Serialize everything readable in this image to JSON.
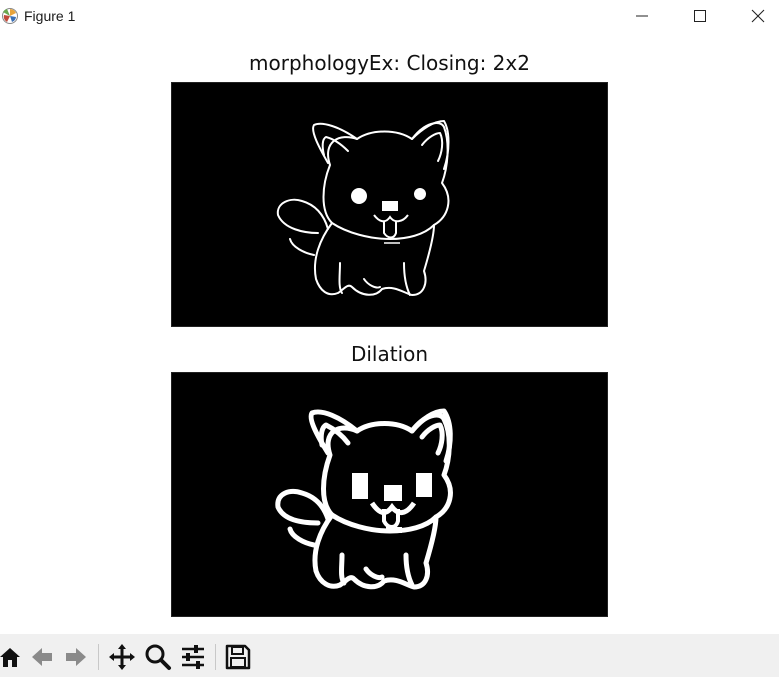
{
  "window": {
    "title": "Figure 1",
    "icons": {
      "app": "matplotlib-logo-icon",
      "minimize": "minimize-icon",
      "maximize": "maximize-icon",
      "close": "close-icon"
    }
  },
  "figure": {
    "subplots": [
      {
        "title": "morphologyEx: Closing: 2x2",
        "image": "thin white outline of a cartoon fox/dog on black background"
      },
      {
        "title": "Dilation",
        "image": "thick white outline of a cartoon fox/dog on black background"
      }
    ]
  },
  "toolbar": {
    "buttons": [
      {
        "name": "home-icon"
      },
      {
        "name": "back-arrow-icon"
      },
      {
        "name": "forward-arrow-icon"
      },
      {
        "name": "pan-icon"
      },
      {
        "name": "zoom-icon"
      },
      {
        "name": "configure-subplots-icon"
      },
      {
        "name": "save-icon"
      }
    ]
  }
}
